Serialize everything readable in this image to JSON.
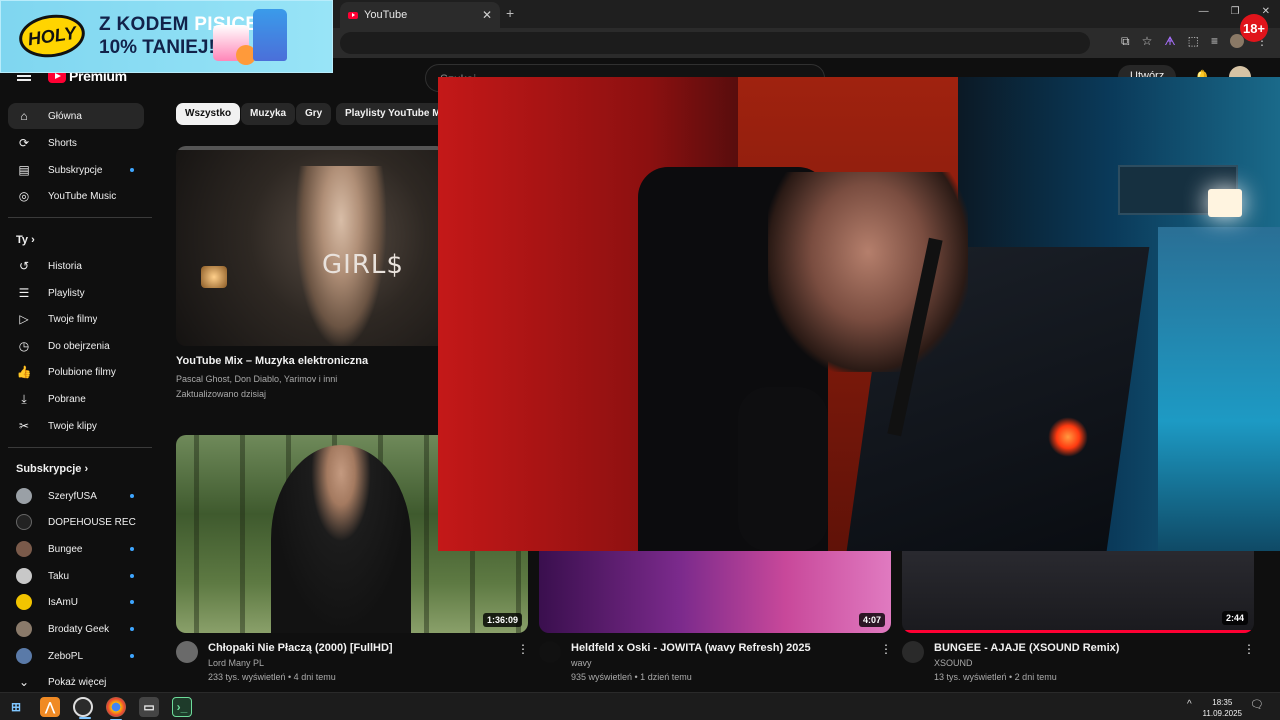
{
  "browser": {
    "tab_title": "YouTube",
    "tab_close": "✕",
    "new_tab": "+",
    "win_controls": [
      "—",
      "❐",
      "✕"
    ],
    "toolbar_icons": [
      "⧉",
      "☆",
      "ᗗ",
      "⬚",
      "≡"
    ],
    "menu": "⋮",
    "age_badge": "18+"
  },
  "ad": {
    "logo": "HOLY",
    "line1_prefix": "Z KODEM ",
    "line1_highlight": "PISICELA",
    "line2": "10% TANIEJ!"
  },
  "header": {
    "logo_text": "Premium",
    "search_placeholder": "Szukaj",
    "create_label": "Utwórz"
  },
  "sidebar": {
    "main": [
      {
        "label": "Główna",
        "icon": "home-icon",
        "glyph": "⌂",
        "active": true,
        "dot": false
      },
      {
        "label": "Shorts",
        "icon": "shorts-icon",
        "glyph": "⟳",
        "active": false,
        "dot": false
      },
      {
        "label": "Subskrypcje",
        "icon": "subscriptions-icon",
        "glyph": "▤",
        "active": false,
        "dot": true
      },
      {
        "label": "YouTube Music",
        "icon": "music-icon",
        "glyph": "◎",
        "active": false,
        "dot": false
      }
    ],
    "you_heading": "Ty",
    "you_items": [
      {
        "label": "Historia",
        "icon": "history-icon",
        "glyph": "↺"
      },
      {
        "label": "Playlisty",
        "icon": "playlists-icon",
        "glyph": "☰"
      },
      {
        "label": "Twoje filmy",
        "icon": "your-videos-icon",
        "glyph": "▷"
      },
      {
        "label": "Do obejrzenia",
        "icon": "watch-later-icon",
        "glyph": "◷"
      },
      {
        "label": "Polubione filmy",
        "icon": "liked-icon",
        "glyph": "👍"
      },
      {
        "label": "Pobrane",
        "icon": "download-icon",
        "glyph": "⤓"
      },
      {
        "label": "Twoje klipy",
        "icon": "clips-icon",
        "glyph": "✂"
      }
    ],
    "subs_heading": "Subskrypcje",
    "subscriptions": [
      {
        "label": "SzeryfUSA",
        "color": "#9aa0a6",
        "dot": true
      },
      {
        "label": "DOPEHOUSE RECO...",
        "color": "#222222",
        "dot": false
      },
      {
        "label": "Bungee",
        "color": "#7a5a4a",
        "dot": true
      },
      {
        "label": "Taku",
        "color": "#c8c8c8",
        "dot": true
      },
      {
        "label": "IsAmU",
        "color": "#f2c400",
        "dot": true
      },
      {
        "label": "Brodaty Geek",
        "color": "#8a7a6a",
        "dot": true
      },
      {
        "label": "ZeboPL",
        "color": "#5a7aa8",
        "dot": true
      }
    ],
    "show_more": "Pokaż więcej"
  },
  "chips": [
    "Wszystko",
    "Muzyka",
    "Gry",
    "Playlisty YouTube Mix"
  ],
  "mix": {
    "thumb_text": "GIRL$",
    "title": "YouTube Mix – Muzyka elektroniczna",
    "artists": "Pascal Ghost, Don Diablo, Yarimov i inni",
    "updated": "Zaktualizowano dzisiaj"
  },
  "videos": [
    {
      "title": "Chłopaki Nie Płaczą (2000) [FullHD]",
      "channel": "Lord Many PL",
      "meta": "233 tys. wyświetleń • 4 dni temu",
      "duration": "1:36:09",
      "avatar_color": "#6a6a6a"
    },
    {
      "title": "Heldfeld x Oski - JOWITA (wavy Refresh) 2025",
      "channel": "wavy",
      "meta": "935 wyświetleń • 1 dzień temu",
      "duration": "4:07",
      "avatar_color": "#111111"
    },
    {
      "title": "BUNGEE - AJAJE (XSOUND Remix)",
      "channel": "XSOUND",
      "meta": "13 tys. wyświetleń • 2 dni temu",
      "duration": "2:44",
      "avatar_color": "#2a2a2a"
    }
  ],
  "taskbar": {
    "start": "⊞",
    "time": "18:35",
    "date": "11.09.2025",
    "tray_caret": "^",
    "notification": "🗨"
  },
  "colors": {
    "accent_red": "#ff0033",
    "dot_blue": "#3ea6ff"
  }
}
